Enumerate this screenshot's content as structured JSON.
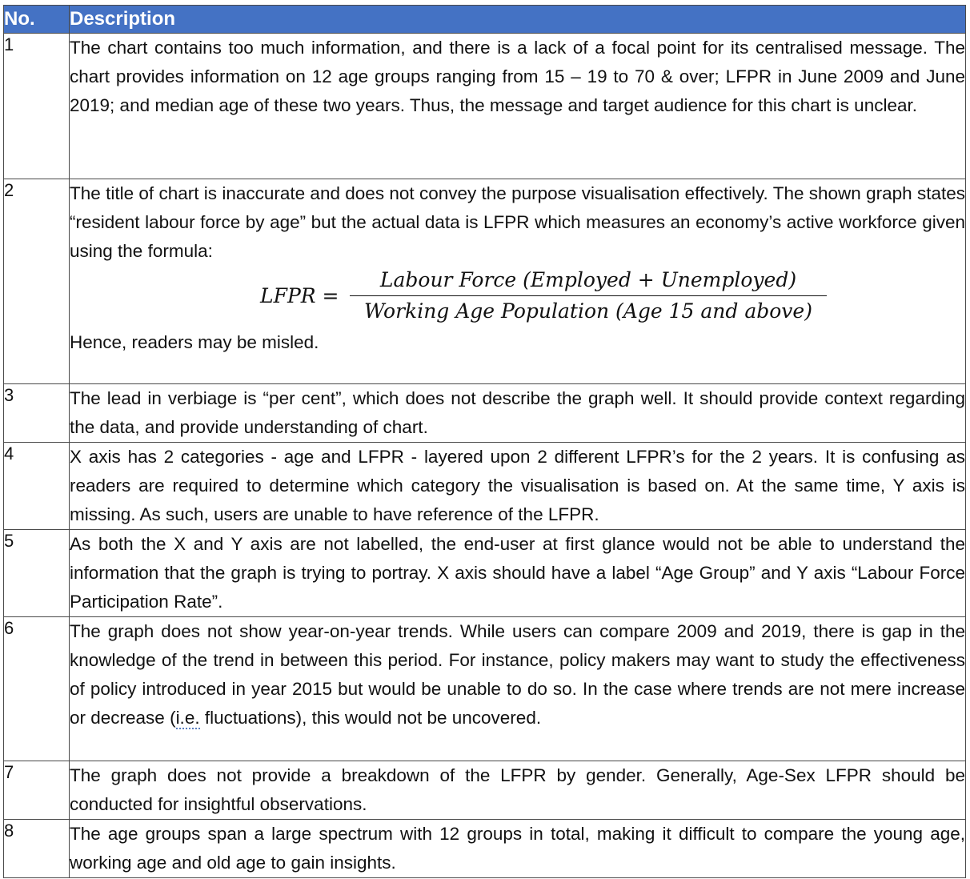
{
  "header": {
    "no_label": "No.",
    "description_label": "Description"
  },
  "colors": {
    "header_bg": "#4472c4",
    "header_text": "#ffffff",
    "border": "#4a4a4a"
  },
  "rows": [
    {
      "no": "1",
      "text": "The chart contains too much information, and there is a lack of a focal point for its centralised message.  The chart provides information on 12 age groups ranging from 15 – 19 to 70 & over; LFPR in June 2009 and June 2019; and median age of these two years. Thus, the message and target audience for this chart is unclear."
    },
    {
      "no": "2",
      "text": "The title of chart is inaccurate and does not convey the purpose visualisation effectively. The shown graph states “resident labour force by age” but the actual data is LFPR which measures an economy’s active workforce given using the formula:",
      "formula": {
        "lhs": "LFPR =",
        "numerator": "Labour Force (Employed + Unemployed)",
        "denominator": "Working Age Population (Age 15 and above)"
      },
      "text_after": "Hence, readers may be misled."
    },
    {
      "no": "3",
      "text": "The lead in verbiage is “per cent”, which does not describe the graph well. It should provide context regarding the data, and provide understanding of chart."
    },
    {
      "no": "4",
      "text": "X axis has 2 categories - age and LFPR - layered upon 2 different LFPR’s for the 2 years. It is confusing as readers are required to determine which category the visualisation is based on. At the same time, Y axis is missing. As such, users are unable to have reference of the LFPR."
    },
    {
      "no": "5",
      "text": "As both the X and Y axis are not labelled, the end-user at first glance would not be able to understand the information that the graph is trying to portray. X axis should have a label “Age Group” and Y axis “Labour Force Participation Rate”."
    },
    {
      "no": "6",
      "text_before": "The graph does not show year-on-year trends. While users can compare 2009 and 2019, there is gap in the knowledge of the trend in between this period. For instance, policy makers may want to study the effectiveness of policy introduced in year 2015 but would be unable to do so. In the case where trends are not mere increase or decrease (",
      "text_ie": "i.e.",
      "text_after": " fluctuations), this would not be uncovered."
    },
    {
      "no": "7",
      "text": "The graph does not provide a breakdown of the LFPR by gender. Generally, Age-Sex LFPR should be conducted for insightful observations."
    },
    {
      "no": "8",
      "text": "The age groups span a large spectrum with 12 groups in total, making it difficult to compare the young age, working age and old age to gain insights."
    }
  ]
}
